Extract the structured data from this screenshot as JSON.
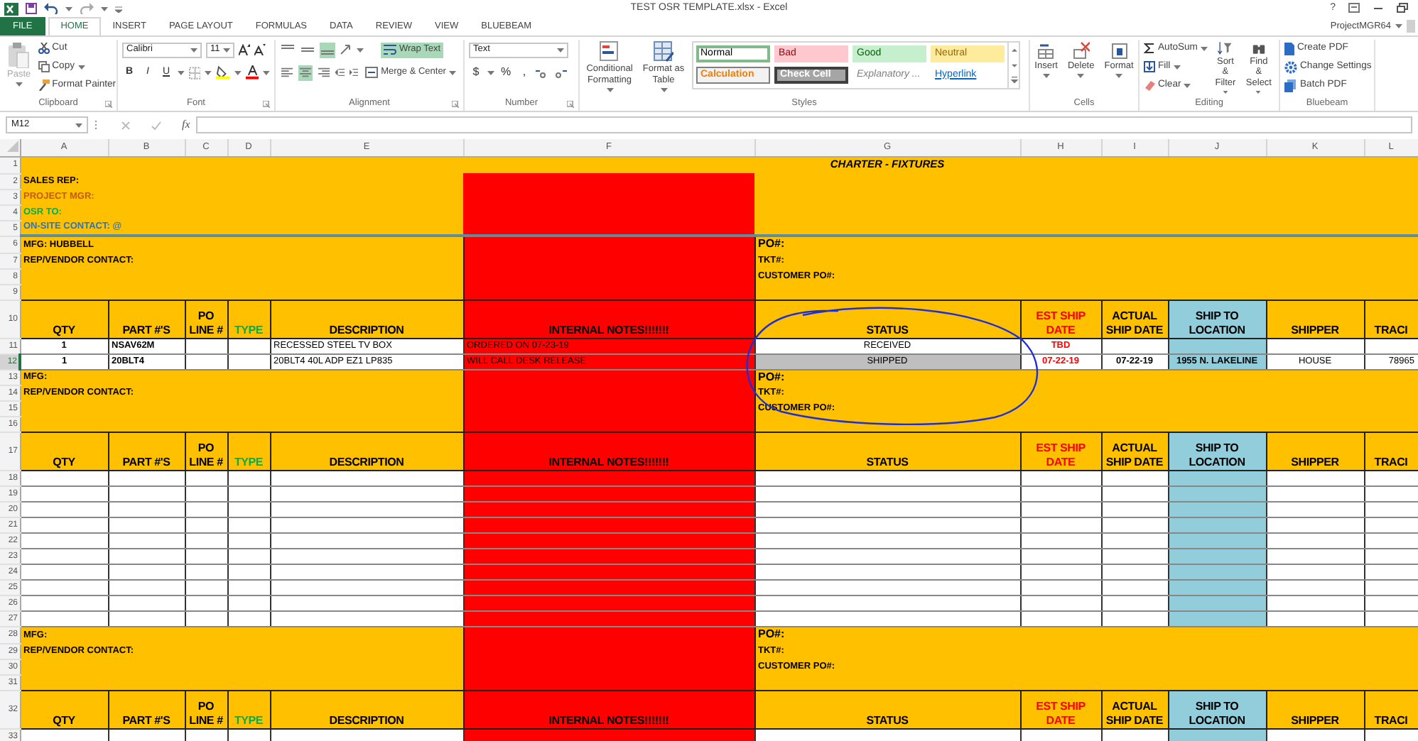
{
  "title_bar": {
    "title": "TEST OSR TEMPLATE.xlsx - Excel",
    "help": "?"
  },
  "account": "ProjectMGR64",
  "ribbon_tabs": [
    {
      "label": "FILE",
      "kind": "file",
      "selected": false
    },
    {
      "label": "HOME",
      "kind": "tab",
      "selected": true
    },
    {
      "label": "INSERT",
      "kind": "tab",
      "selected": false
    },
    {
      "label": "PAGE LAYOUT",
      "kind": "tab",
      "selected": false
    },
    {
      "label": "FORMULAS",
      "kind": "tab",
      "selected": false
    },
    {
      "label": "DATA",
      "kind": "tab",
      "selected": false
    },
    {
      "label": "REVIEW",
      "kind": "tab",
      "selected": false
    },
    {
      "label": "VIEW",
      "kind": "tab",
      "selected": false
    },
    {
      "label": "BLUEBEAM",
      "kind": "tab",
      "selected": false
    }
  ],
  "ribbon_groups": [
    {
      "label": "Clipboard",
      "commands": [
        {
          "label": "Paste",
          "disabled": true
        },
        {
          "label": "Cut",
          "disabled": false
        },
        {
          "label": "Copy",
          "disabled": false
        },
        {
          "label": "Format Painter",
          "disabled": false
        }
      ]
    },
    {
      "label": "Font",
      "font_name": "Calibri",
      "font_size": "11",
      "commands": [
        {
          "label": "B"
        },
        {
          "label": "I"
        },
        {
          "label": "U"
        }
      ]
    },
    {
      "label": "Alignment",
      "vertical_align": [
        {
          "selected": false
        },
        {
          "selected": false
        },
        {
          "selected": true
        }
      ],
      "horizontal_align": [
        {
          "selected": false
        },
        {
          "selected": true
        },
        {
          "selected": false
        }
      ],
      "commands": [
        {
          "label": "Wrap Text",
          "on": true
        },
        {
          "label": "Merge & Center",
          "on": false
        }
      ]
    },
    {
      "label": "Number",
      "format": "Text",
      "commands": [
        {
          "label": "$"
        },
        {
          "label": "%"
        },
        {
          "label": ","
        }
      ]
    },
    {
      "label": "Styles",
      "commands": [
        {
          "label": "Conditional Formatting"
        },
        {
          "label": "Format as Table"
        }
      ],
      "cell_styles": [
        {
          "label": "Normal",
          "kind": "normal",
          "selected": true
        },
        {
          "label": "Bad",
          "kind": "bad",
          "selected": false
        },
        {
          "label": "Good",
          "kind": "good",
          "selected": false
        },
        {
          "label": "Neutral",
          "kind": "neutral",
          "selected": false
        },
        {
          "label": "Calculation",
          "kind": "calculation",
          "selected": false
        },
        {
          "label": "Check Cell",
          "kind": "check",
          "selected": false
        },
        {
          "label": "Explanatory ...",
          "kind": "explanatory",
          "selected": false
        },
        {
          "label": "Hyperlink",
          "kind": "hyperlink",
          "selected": false
        }
      ]
    },
    {
      "label": "Cells",
      "commands": [
        {
          "label": "Insert"
        },
        {
          "label": "Delete"
        },
        {
          "label": "Format"
        }
      ]
    },
    {
      "label": "Editing",
      "commands": [
        {
          "label": "AutoSum"
        },
        {
          "label": "Fill"
        },
        {
          "label": "Clear"
        },
        {
          "label": "Sort & Filter"
        },
        {
          "label": "Find & Select"
        }
      ]
    },
    {
      "label": "Bluebeam",
      "commands": [
        {
          "label": "Create PDF"
        },
        {
          "label": "Change Settings"
        },
        {
          "label": "Batch PDF"
        }
      ]
    }
  ],
  "formula_bar": {
    "name_box": "M12",
    "function_label": "fx"
  },
  "sheet": {
    "columns": [
      {
        "letter": "A",
        "color": "#ffffff"
      },
      {
        "letter": "B",
        "color": "#ffffff"
      },
      {
        "letter": "C",
        "color": "#ffffff"
      },
      {
        "letter": "D",
        "color": "#ffffff"
      },
      {
        "letter": "E",
        "color": "#ffffff"
      },
      {
        "letter": "F",
        "color": "#ff0000"
      },
      {
        "letter": "G",
        "color": "#ffffff"
      },
      {
        "letter": "H",
        "color": "#ffffff"
      },
      {
        "letter": "I",
        "color": "#ffffff"
      },
      {
        "letter": "J",
        "color": "#92cddc"
      },
      {
        "letter": "K",
        "color": "#ffffff"
      },
      {
        "letter": "L",
        "color": "#ffffff"
      }
    ],
    "title_row": {
      "number": "1",
      "title": "CHARTER - FIXTURES"
    },
    "contact_rows": [
      {
        "number": "2",
        "label": "SALES REP:",
        "color": "#000000"
      },
      {
        "number": "3",
        "label": "PROJECT MGR:",
        "color": "#c55a11"
      },
      {
        "number": "4",
        "label": "OSR TO:",
        "color": "#00b050"
      },
      {
        "number": "5",
        "label": "ON-SITE CONTACT: @",
        "color": "#2e75b6"
      }
    ],
    "vendor_blocks": [
      {
        "info_rows": [
          {
            "number": "6",
            "left": "MFG: HUBBELL",
            "right": "PO#:"
          },
          {
            "number": "7",
            "left": "REP/VENDOR CONTACT:",
            "right": "TKT#:"
          },
          {
            "number": "8",
            "right": "CUSTOMER PO#:"
          },
          {
            "number": "9"
          }
        ],
        "header": {
          "number": "10",
          "labels": [
            {
              "text": "QTY",
              "color": "#000000"
            },
            {
              "text": "PART #'S",
              "color": "#000000"
            },
            {
              "text": "PO LINE #",
              "color": "#000000"
            },
            {
              "text": "TYPE",
              "color": "#00b050"
            },
            {
              "text": "DESCRIPTION",
              "color": "#000000"
            },
            {
              "text": "INTERNAL NOTES!!!!!!!",
              "color": "#000000"
            },
            {
              "text": "STATUS",
              "color": "#000000"
            },
            {
              "text": "EST SHIP DATE",
              "color": "#ff0000"
            },
            {
              "text": "ACTUAL SHIP DATE",
              "color": "#000000"
            },
            {
              "text": "SHIP TO LOCATION",
              "color": "#000000"
            },
            {
              "text": "SHIPPER",
              "color": "#000000"
            },
            {
              "text": "TRACI",
              "color": "#000000"
            }
          ]
        },
        "item_rows": [
          {
            "number": "11",
            "selected": false,
            "status_highlighted": false,
            "qty": "1",
            "part": "NSAV62M",
            "description": "RECESSED STEEL TV BOX",
            "notes": "ORDERED ON 07-23-19",
            "status": "RECEIVED",
            "est_ship_date": "TBD"
          },
          {
            "number": "12",
            "selected": true,
            "status_highlighted": true,
            "qty": "1",
            "part": "20BLT4",
            "description": "20BLT4 40L ADP EZ1 LP835",
            "notes": "WILL CALL DESK RELEASE",
            "status": "SHIPPED",
            "est_ship_date": "07-22-19",
            "actual_ship_date": "07-22-19",
            "ship_to": "1955 N. LAKELINE",
            "shipper": "HOUSE",
            "column_12": "78965"
          }
        ]
      },
      {
        "info_rows": [
          {
            "number": "13",
            "left": "MFG:",
            "right": "PO#:"
          },
          {
            "number": "14",
            "left": "REP/VENDOR CONTACT:",
            "right": "TKT#:"
          },
          {
            "number": "15",
            "right": "CUSTOMER PO#:"
          },
          {
            "number": "16"
          }
        ],
        "header": {
          "number": "17",
          "labels": [
            {
              "text": "QTY",
              "color": "#000000"
            },
            {
              "text": "PART #'S",
              "color": "#000000"
            },
            {
              "text": "PO LINE #",
              "color": "#000000"
            },
            {
              "text": "TYPE",
              "color": "#00b050"
            },
            {
              "text": "DESCRIPTION",
              "color": "#000000"
            },
            {
              "text": "INTERNAL NOTES!!!!!!!",
              "color": "#000000"
            },
            {
              "text": "STATUS",
              "color": "#000000"
            },
            {
              "text": "EST SHIP DATE",
              "color": "#ff0000"
            },
            {
              "text": "ACTUAL SHIP DATE",
              "color": "#000000"
            },
            {
              "text": "SHIP TO LOCATION",
              "color": "#000000"
            },
            {
              "text": "SHIPPER",
              "color": "#000000"
            },
            {
              "text": "TRACI",
              "color": "#000000"
            }
          ]
        },
        "item_rows": [
          {
            "number": "18",
            "selected": false,
            "status_highlighted": false
          },
          {
            "number": "19",
            "selected": false,
            "status_highlighted": false
          },
          {
            "number": "20",
            "selected": false,
            "status_highlighted": false
          },
          {
            "number": "21",
            "selected": false,
            "status_highlighted": false
          },
          {
            "number": "22",
            "selected": false,
            "status_highlighted": false
          },
          {
            "number": "23",
            "selected": false,
            "status_highlighted": false
          },
          {
            "number": "24",
            "selected": false,
            "status_highlighted": false
          },
          {
            "number": "25",
            "selected": false,
            "status_highlighted": false
          },
          {
            "number": "26",
            "selected": false,
            "status_highlighted": false
          },
          {
            "number": "27",
            "selected": false,
            "status_highlighted": false
          }
        ]
      },
      {
        "info_rows": [
          {
            "number": "28",
            "left": "MFG:",
            "right": "PO#:"
          },
          {
            "number": "29",
            "left": "REP/VENDOR CONTACT:",
            "right": "TKT#:"
          },
          {
            "number": "30",
            "right": "CUSTOMER PO#:"
          },
          {
            "number": "31"
          }
        ],
        "header": {
          "number": "32",
          "labels": [
            {
              "text": "QTY",
              "color": "#000000"
            },
            {
              "text": "PART #'S",
              "color": "#000000"
            },
            {
              "text": "PO LINE #",
              "color": "#000000"
            },
            {
              "text": "TYPE",
              "color": "#00b050"
            },
            {
              "text": "DESCRIPTION",
              "color": "#000000"
            },
            {
              "text": "INTERNAL NOTES!!!!!!!",
              "color": "#000000"
            },
            {
              "text": "STATUS",
              "color": "#000000"
            },
            {
              "text": "EST SHIP DATE",
              "color": "#ff0000"
            },
            {
              "text": "ACTUAL SHIP DATE",
              "color": "#000000"
            },
            {
              "text": "SHIP TO LOCATION",
              "color": "#000000"
            },
            {
              "text": "SHIPPER",
              "color": "#000000"
            },
            {
              "text": "TRACI",
              "color": "#000000"
            }
          ]
        },
        "item_rows": [
          {
            "number": "33",
            "selected": false,
            "status_highlighted": false
          }
        ]
      }
    ]
  }
}
